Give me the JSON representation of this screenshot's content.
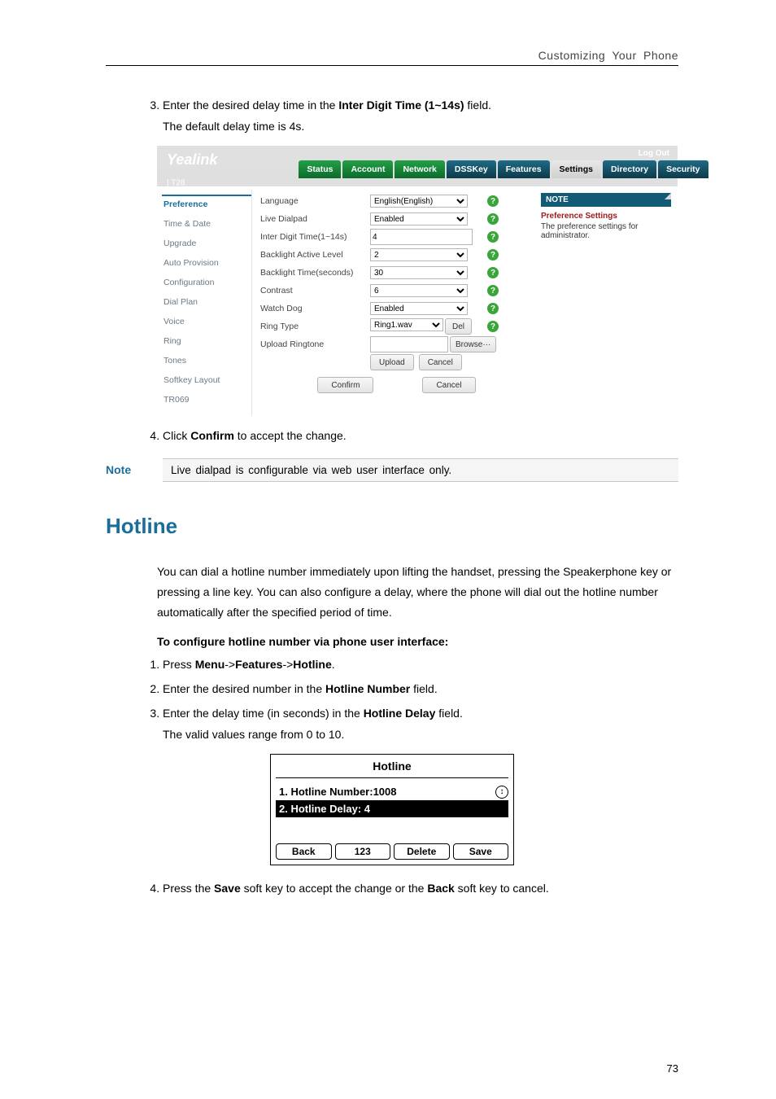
{
  "pageHeader": "Customizing Your Phone",
  "pageNumber": "73",
  "steps_a": {
    "num3_text_pre": "Enter the desired delay time in the ",
    "num3_bold": "Inter Digit Time (1~14s)",
    "num3_text_post": " field.",
    "num3_sub": "The default delay time is 4s.",
    "num4_pre": "Click ",
    "num4_bold": "Confirm",
    "num4_post": " to accept the change."
  },
  "note": {
    "label": "Note",
    "text": "Live dialpad is configurable via web user interface only."
  },
  "section_title": "Hotline",
  "section_para": "You can dial a hotline number immediately upon lifting the handset, pressing the Speakerphone key or pressing a line key. You can also configure a delay, where the phone will dial out the hotline number automatically after the specified period of time.",
  "section_sub": "To configure hotline number via phone user interface:",
  "steps_b": {
    "s1_pre": "Press ",
    "s1_b1": "Menu",
    "s1_mid1": "->",
    "s1_b2": "Features",
    "s1_mid2": "->",
    "s1_b3": "Hotline",
    "s1_post": ".",
    "s2_pre": "Enter the desired number in the ",
    "s2_b": "Hotline Number",
    "s2_post": " field.",
    "s3_pre": "Enter the delay time (in seconds) in the ",
    "s3_b": "Hotline Delay",
    "s3_post": " field.",
    "s3_sub": "The valid values range from 0 to 10.",
    "s4_pre": "Press the ",
    "s4_b1": "Save",
    "s4_mid": " soft key to accept the change or the ",
    "s4_b2": "Back",
    "s4_post": " soft key to cancel."
  },
  "admin": {
    "brand": "Yealink",
    "brand_model": "T28",
    "logout": "Log Out",
    "tabs": [
      "Status",
      "Account",
      "Network",
      "DSSKey",
      "Features",
      "Settings",
      "Directory",
      "Security"
    ],
    "active_tab_index": 5,
    "sidebar": [
      "Preference",
      "Time & Date",
      "Upgrade",
      "Auto Provision",
      "Configuration",
      "Dial Plan",
      "Voice",
      "Ring",
      "Tones",
      "Softkey Layout",
      "TR069"
    ],
    "sidebar_selected_index": 0,
    "fields": {
      "language_label": "Language",
      "language_value": "English(English)",
      "live_dialpad_label": "Live Dialpad",
      "live_dialpad_value": "Enabled",
      "inter_digit_label": "Inter Digit Time(1~14s)",
      "inter_digit_value": "4",
      "backlight_active_label": "Backlight Active Level",
      "backlight_active_value": "2",
      "backlight_time_label": "Backlight Time(seconds)",
      "backlight_time_value": "30",
      "contrast_label": "Contrast",
      "contrast_value": "6",
      "watchdog_label": "Watch Dog",
      "watchdog_value": "Enabled",
      "ringtype_label": "Ring Type",
      "ringtype_value": "Ring1.wav",
      "ringtype_del": "Del",
      "upload_label": "Upload Ringtone",
      "upload_browse": "Browse···",
      "upload_btn": "Upload",
      "upload_cancel": "Cancel",
      "confirm_btn": "Confirm",
      "bottom_cancel": "Cancel"
    },
    "rightnote": {
      "box": "NOTE",
      "title": "Preference Settings",
      "desc": "The preference settings for administrator."
    }
  },
  "device": {
    "title": "Hotline",
    "row1": "1. Hotline Number:1008",
    "row2": "2. Hotline Delay:   4",
    "softkeys": [
      "Back",
      "123",
      "Delete",
      "Save"
    ]
  }
}
